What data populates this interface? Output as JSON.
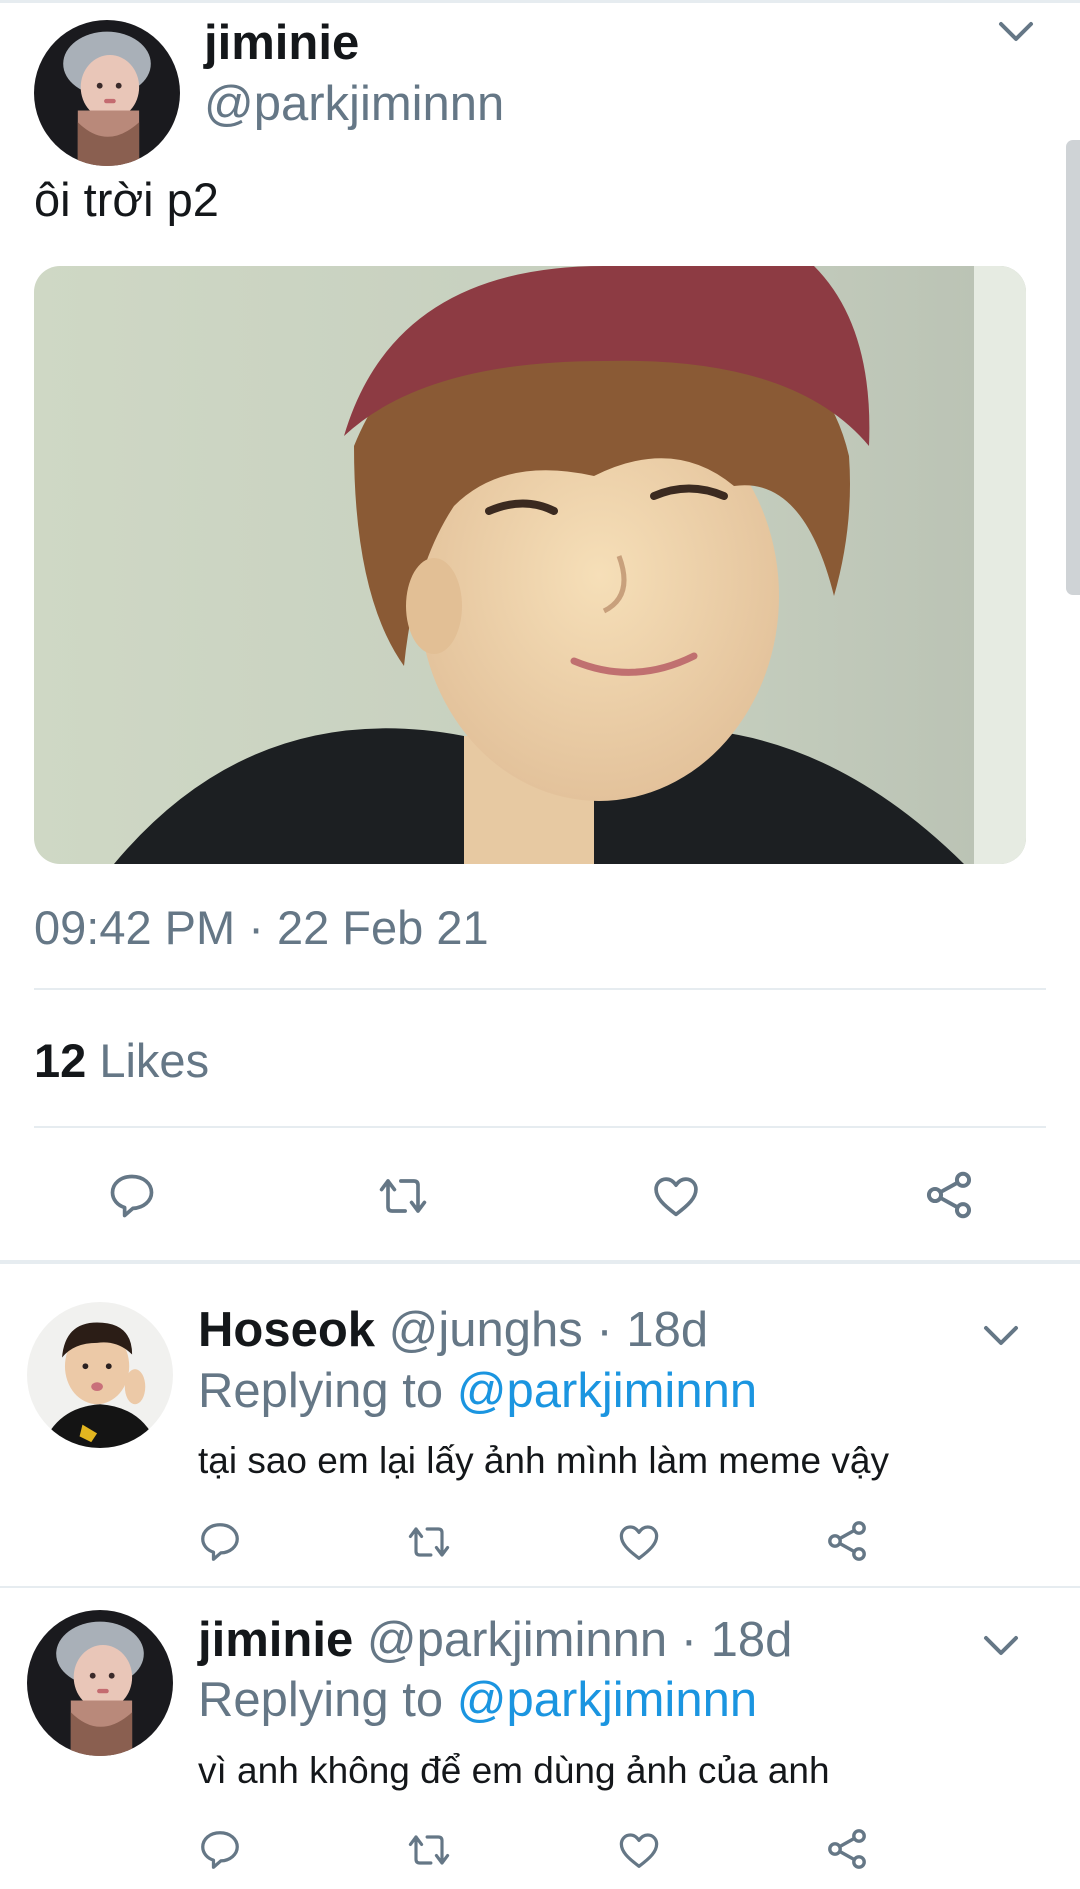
{
  "tweet": {
    "author_name": "jiminie",
    "author_handle": "@parkjiminnn",
    "text": "ôi trời p2",
    "timestamp": "09:42 PM · 22 Feb 21",
    "likes_count": "12",
    "likes_label": "Likes"
  },
  "replies": [
    {
      "name": "Hoseok",
      "handle_time": "@junghs · 18d",
      "replying_prefix": "Replying to",
      "replying_to": "@parkjiminnn",
      "text": "tại sao em lại lấy ảnh mình làm meme vậy"
    },
    {
      "name": "jiminie",
      "handle_time": "@parkjiminnn · 18d",
      "replying_prefix": "Replying to",
      "replying_to": "@parkjiminnn",
      "text": "vì anh không để em dùng ảnh của anh"
    }
  ],
  "icons": [
    "chevron-down-icon",
    "reply-icon",
    "retweet-icon",
    "heart-icon",
    "share-icon"
  ],
  "colors": {
    "text": "#14171a",
    "secondary": "#657786",
    "link": "#1b95e0",
    "divider": "#e6ecf0"
  }
}
